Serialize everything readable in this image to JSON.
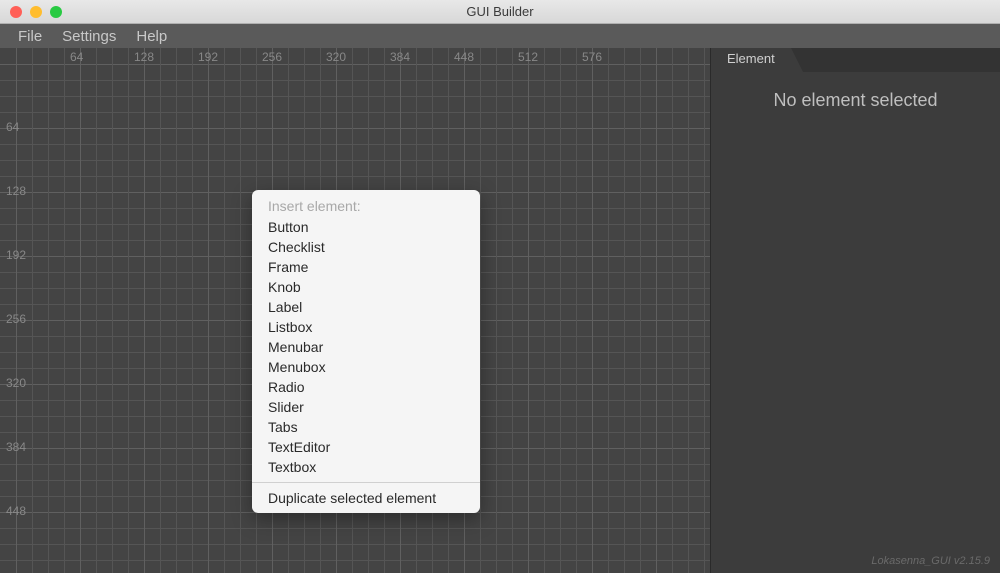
{
  "window": {
    "title": "GUI Builder"
  },
  "menubar": {
    "items": [
      "File",
      "Settings",
      "Help"
    ]
  },
  "ruler": {
    "h_labels": [
      "64",
      "128",
      "192",
      "256",
      "320",
      "384",
      "448",
      "512",
      "576"
    ],
    "v_labels": [
      "64",
      "128",
      "192",
      "256",
      "320",
      "384",
      "448"
    ]
  },
  "context_menu": {
    "header": "Insert element:",
    "elements": [
      "Button",
      "Checklist",
      "Frame",
      "Knob",
      "Label",
      "Listbox",
      "Menubar",
      "Menubox",
      "Radio",
      "Slider",
      "Tabs",
      "TextEditor",
      "Textbox"
    ],
    "duplicate": "Duplicate selected element"
  },
  "side_panel": {
    "tab": "Element",
    "message": "No element selected"
  },
  "footer": {
    "credit": "Lokasenna_GUI v2.15.9"
  }
}
